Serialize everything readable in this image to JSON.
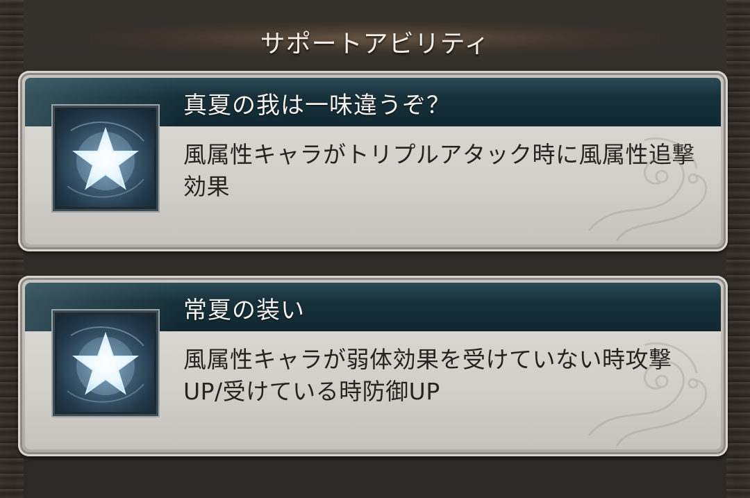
{
  "header": {
    "title": "サポートアビリティ"
  },
  "abilities": [
    {
      "icon": "star-icon",
      "name": "真夏の我は一味違うぞ？",
      "description": "風属性キャラがトリプルアタック時に風属性追撃効果"
    },
    {
      "icon": "star-icon",
      "name": "常夏の装い",
      "description": "風属性キャラが弱体効果を受けていない時攻撃UP/受けている時防御UP"
    }
  ],
  "colors": {
    "header_band": "#112832",
    "panel_body": "#d3d0cb",
    "star_glow": "#e8f6ff"
  }
}
